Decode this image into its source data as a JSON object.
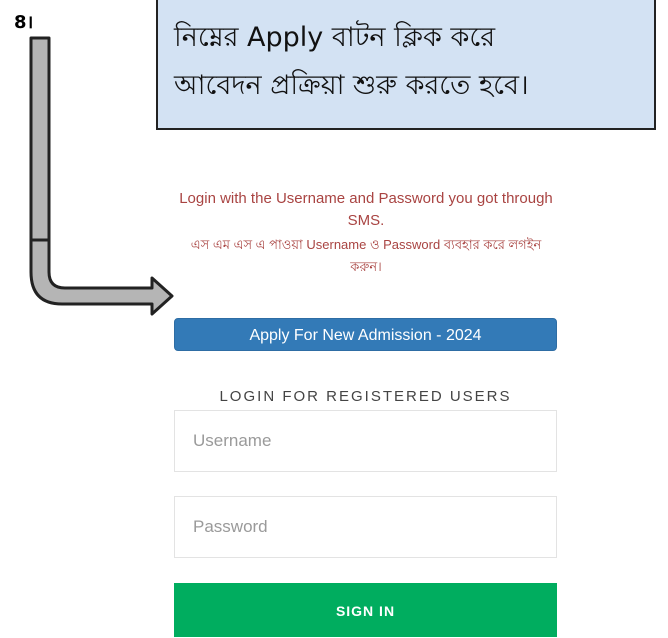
{
  "step": {
    "number": "8।"
  },
  "callout": {
    "line1": "নিম্নের Apply বাটন ক্লিক করে",
    "line2": "আবেদন প্রক্রিয়া শুরু করতে হবে।"
  },
  "notice": {
    "english": "Login with the Username and Password you got through SMS.",
    "bangla": "এস এম এস এ পাওয়া Username ও Password ব্যবহার করে লগইন করুন।"
  },
  "apply_button": {
    "label": "Apply For New Admission - 2024"
  },
  "login": {
    "heading": "LOGIN FOR REGISTERED USERS",
    "username_placeholder": "Username",
    "password_placeholder": "Password",
    "signin_label": "SIGN IN"
  },
  "colors": {
    "callout_bg": "#d3e2f3",
    "notice_text": "#a94442",
    "apply_bg": "#337ab7",
    "signin_bg": "#00ad5f",
    "arrow_fill": "#b5b5b5"
  },
  "icons": {
    "pointer": "bent-arrow-icon"
  }
}
